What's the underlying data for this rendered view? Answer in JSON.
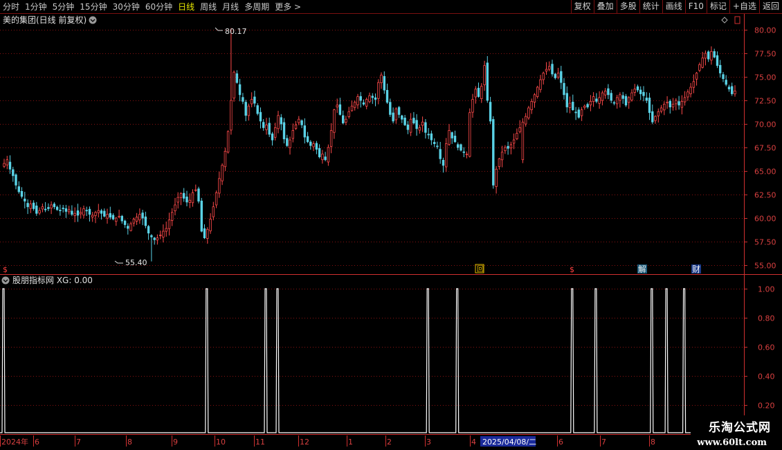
{
  "toolbar": {
    "periods": [
      "分时",
      "1分钟",
      "5分钟",
      "15分钟",
      "30分钟",
      "60分钟",
      "日线",
      "周线",
      "月线",
      "多周期",
      "更多 >"
    ],
    "active_period": "日线",
    "actions": [
      "复权",
      "叠加",
      "多股",
      "统计",
      "画线",
      "F10",
      "标记",
      "+自选",
      "返回"
    ]
  },
  "main_panel": {
    "title": "美的集团(日线 前复权)",
    "y_ticks": [
      "80.00",
      "77.50",
      "75.00",
      "72.50",
      "70.00",
      "67.50",
      "65.00",
      "62.50",
      "60.00",
      "57.50",
      "55.00"
    ],
    "max_label": "80.17",
    "min_label": "55.40",
    "event_markers": [
      "$",
      "回",
      "$",
      "解",
      "财"
    ]
  },
  "indicator_panel": {
    "title": "股朋指标网 XG: 0.00",
    "y_ticks": [
      "1.00",
      "0.80",
      "0.60",
      "0.40",
      "0.20"
    ]
  },
  "time_axis": {
    "labels": [
      "2024年",
      "6",
      "7",
      "8",
      "9",
      "10",
      "11",
      "12",
      "1",
      "2",
      "3",
      "4",
      "6",
      "7",
      "8"
    ],
    "cursor_date": "2025/04/08/二"
  },
  "watermark": {
    "name": "乐淘公式网",
    "url": "www.60lt.com"
  },
  "colors": {
    "up": "#ff4a4a",
    "down": "#5ad2e6",
    "grid": "#8a1212",
    "axis": "#d23030",
    "signal": "#ffffff"
  },
  "chart_data": {
    "type": "candlestick",
    "y_range": [
      55.0,
      80.0
    ],
    "max_price": 80.17,
    "min_price": 55.4,
    "closes": [
      65.8,
      66.2,
      65.2,
      64.5,
      63.5,
      62.8,
      62.3,
      61.8,
      61.2,
      61.5,
      61.0,
      60.5,
      60.8,
      61.2,
      60.9,
      61.0,
      61.4,
      61.2,
      60.9,
      60.8,
      61.0,
      60.7,
      60.9,
      60.4,
      60.5,
      60.3,
      60.6,
      61.0,
      60.8,
      60.4,
      60.3,
      60.6,
      60.8,
      60.5,
      60.2,
      60.4,
      60.1,
      59.9,
      60.0,
      60.2,
      59.7,
      59.3,
      58.9,
      59.4,
      59.9,
      60.1,
      60.4,
      60.0,
      59.2,
      58.4,
      58.0,
      57.7,
      57.9,
      58.2,
      58.6,
      58.9,
      59.8,
      60.6,
      61.4,
      62.2,
      62.6,
      62.1,
      61.7,
      61.9,
      62.7,
      63.0,
      61.8,
      58.6,
      57.9,
      58.8,
      59.9,
      61.2,
      62.7,
      64.2,
      65.6,
      67.1,
      69.2,
      72.5,
      75.5,
      74.4,
      73.1,
      72.4,
      70.9,
      71.9,
      72.6,
      72.2,
      71.1,
      70.3,
      69.6,
      69.9,
      68.9,
      68.3,
      69.6,
      70.9,
      70.0,
      68.4,
      67.7,
      68.3,
      69.3,
      69.9,
      70.5,
      69.9,
      68.6,
      68.1,
      67.7,
      67.9,
      67.3,
      66.5,
      66.8,
      66.2,
      67.5,
      69.3,
      71.5,
      72.0,
      71.0,
      70.1,
      70.5,
      71.3,
      71.9,
      72.3,
      72.9,
      72.5,
      72.1,
      72.6,
      73.0,
      72.8,
      72.6,
      74.4,
      75.2,
      73.6,
      72.3,
      71.0,
      70.3,
      71.6,
      71.0,
      70.5,
      69.9,
      69.4,
      70.5,
      70.1,
      69.5,
      69.6,
      70.2,
      69.1,
      68.9,
      68.3,
      67.9,
      67.6,
      66.3,
      65.6,
      67.9,
      69.3,
      68.5,
      68.1,
      67.5,
      67.2,
      67.0,
      66.8,
      71.2,
      72.6,
      73.7,
      72.9,
      74.0,
      76.2,
      72.5,
      70.3,
      63.5,
      65.2,
      66.3,
      67.0,
      67.5,
      67.4,
      67.8,
      68.3,
      69.0,
      69.6,
      70.2,
      70.8,
      71.7,
      72.4,
      73.1,
      73.9,
      74.7,
      75.4,
      75.8,
      76.1,
      75.3,
      74.9,
      75.4,
      74.4,
      73.1,
      71.8,
      72.2,
      71.5,
      71.2,
      70.7,
      71.5,
      71.9,
      71.8,
      72.4,
      72.9,
      72.4,
      72.8,
      73.3,
      73.5,
      73.1,
      72.5,
      72.2,
      72.8,
      73.1,
      72.7,
      72.0,
      72.8,
      73.3,
      73.7,
      73.6,
      73.2,
      73.0,
      72.5,
      71.2,
      70.2,
      70.8,
      71.3,
      71.7,
      72.1,
      72.3,
      71.8,
      72.1,
      72.5,
      72.0,
      72.4,
      72.8,
      73.4,
      73.9,
      74.5,
      75.4,
      76.3,
      77.0,
      77.5,
      76.9,
      77.7,
      77.1,
      76.2,
      75.4,
      74.8,
      74.2,
      73.7,
      73.2,
      73.5
    ]
  }
}
